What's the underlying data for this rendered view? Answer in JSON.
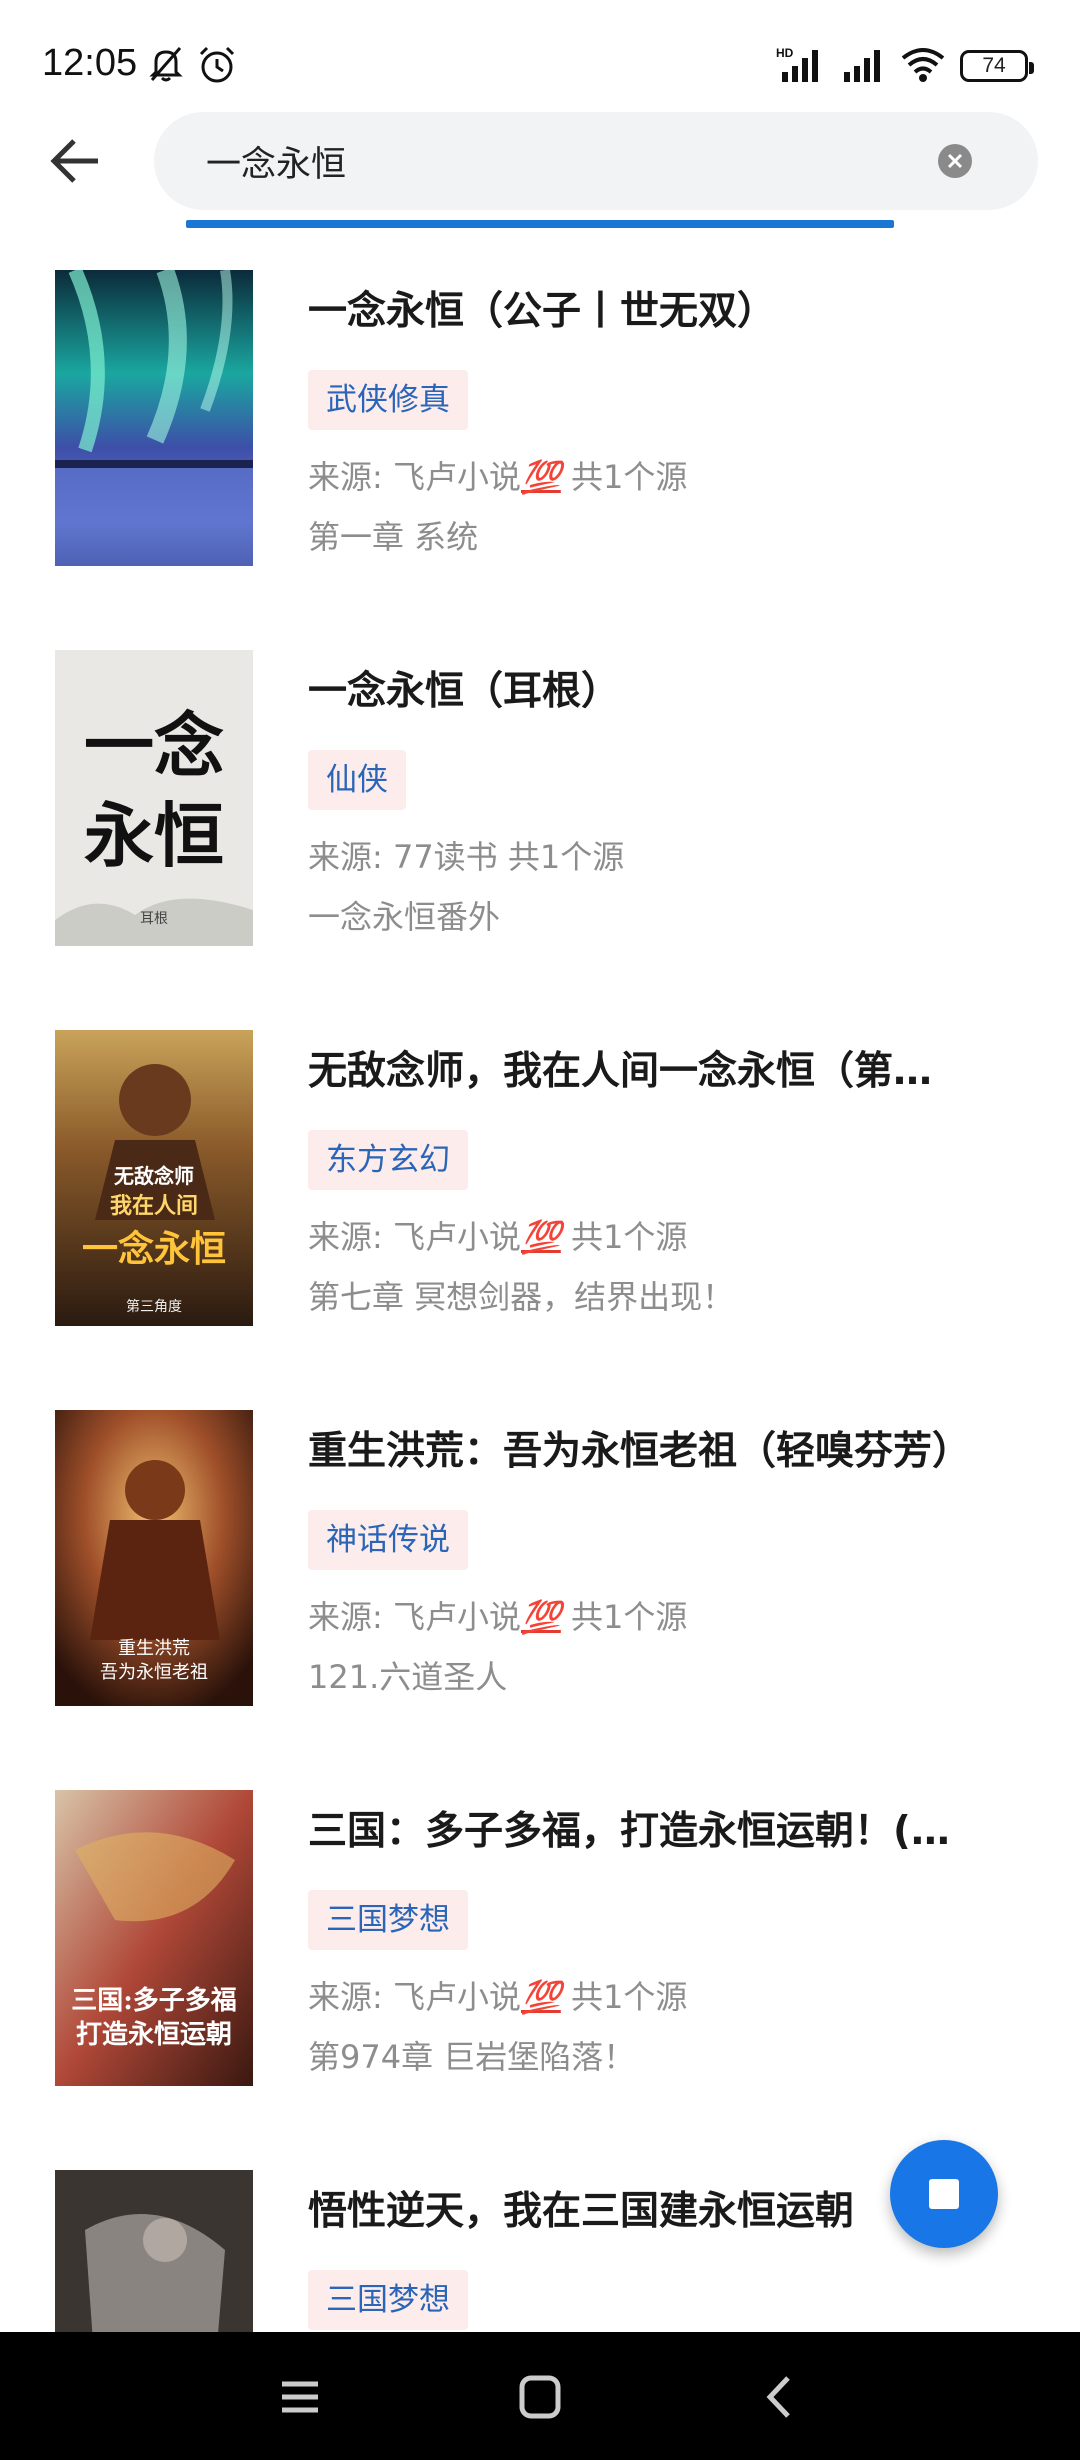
{
  "status_bar": {
    "time": "12:05",
    "battery": "74",
    "icons": [
      "mute-bell-icon",
      "alarm-icon",
      "hd-signal-icon",
      "signal-icon",
      "wifi-icon",
      "battery-icon"
    ]
  },
  "header": {
    "back_icon": "arrow-left-icon",
    "search_value": "一念永恒",
    "clear_icon": "clear-circle-icon",
    "accent_color": "#1976d2"
  },
  "results": [
    {
      "title": "一念永恒（公子丨世无双）",
      "tag": "武侠修真",
      "source": "来源: 飞卢小说",
      "source_badge": "💯",
      "source_count": "共1个源",
      "latest": "第一章 系统"
    },
    {
      "title": "一念永恒（耳根）",
      "tag": "仙侠",
      "source": "来源: 77读书",
      "source_badge": "",
      "source_count": "共1个源",
      "latest": "一念永恒番外"
    },
    {
      "title": "无敌念师，我在人间一念永恒（第…",
      "tag": "东方玄幻",
      "source": "来源: 飞卢小说",
      "source_badge": "💯",
      "source_count": "共1个源",
      "latest": "第七章 冥想剑器，结界出现！"
    },
    {
      "title": "重生洪荒：吾为永恒老祖（轻嗅芬芳）",
      "tag": "神话传说",
      "source": "来源: 飞卢小说",
      "source_badge": "💯",
      "source_count": "共1个源",
      "latest": "121.六道圣人"
    },
    {
      "title": "三国：多子多福，打造永恒运朝！(…",
      "tag": "三国梦想",
      "source": "来源: 飞卢小说",
      "source_badge": "💯",
      "source_count": "共1个源",
      "latest": "第974章 巨岩堡陷落！"
    },
    {
      "title": "悟性逆天，我在三国建永恒运朝",
      "tag": "三国梦想",
      "source": "",
      "source_badge": "",
      "source_count": "",
      "latest": ""
    }
  ],
  "covers": {
    "c2_line1": "一念",
    "c2_line2": "永恒",
    "c2_author": "耳根",
    "c3_line1": "无敌念师",
    "c3_line2": "我在人间",
    "c3_line3": "一念永恒",
    "c3_author": "第三角度",
    "c4_line1": "重生洪荒",
    "c4_line2": "吾为永恒老祖",
    "c5_line1": "三国:多子多福",
    "c5_line2": "打造永恒运朝"
  },
  "fab": {
    "icon": "stop-icon",
    "color": "#1976e6"
  },
  "nav_bar": {
    "icons": [
      "menu-icon",
      "home-icon",
      "back-icon"
    ]
  }
}
